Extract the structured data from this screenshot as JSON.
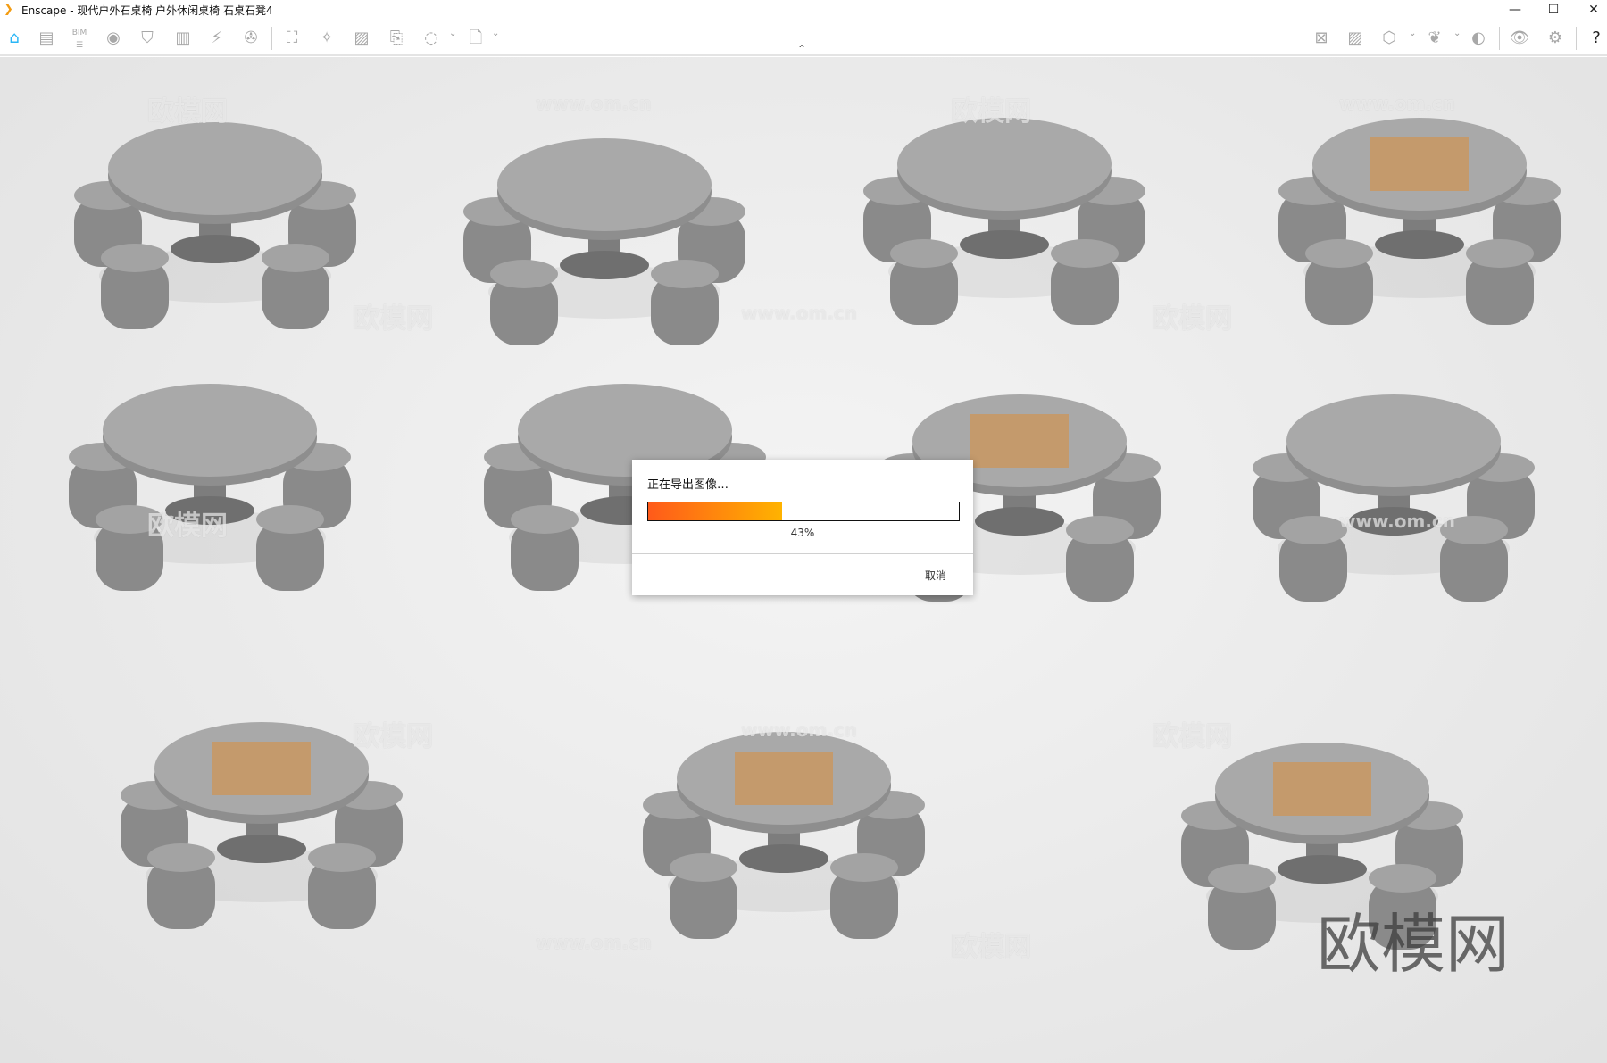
{
  "window": {
    "title": "Enscape - 现代户外石桌椅 户外休闲桌椅 石桌石凳4",
    "minimize": "—",
    "maximize": "☐",
    "close": "✕"
  },
  "toolbar": {
    "left_icons": [
      "home-icon",
      "notes-icon",
      "bim-icon",
      "view-icon",
      "site-icon",
      "building-icon",
      "energy-icon",
      "video-icon",
      "screenshot-icon",
      "magic-icon",
      "image-icon",
      "export-batch-icon",
      "panorama-360-icon",
      "export-exe-icon"
    ],
    "right_icons": [
      "map-icon",
      "gallery-icon",
      "asset-cube-icon",
      "wing-icon",
      "vr-headset-icon",
      "visual-settings-icon",
      "settings-icon",
      "help-icon"
    ],
    "bim_label": "BIM",
    "accent": "#29b6f6"
  },
  "viewport": {
    "watermarks": [
      "欧模网",
      "www.om.cn"
    ],
    "big_watermark": "欧模网"
  },
  "dialog": {
    "title": "正在导出图像…",
    "progress_percent": 43,
    "progress_label": "43%",
    "cancel": "取消",
    "fill_start": "#ff5a1a",
    "fill_end": "#ffb300"
  }
}
